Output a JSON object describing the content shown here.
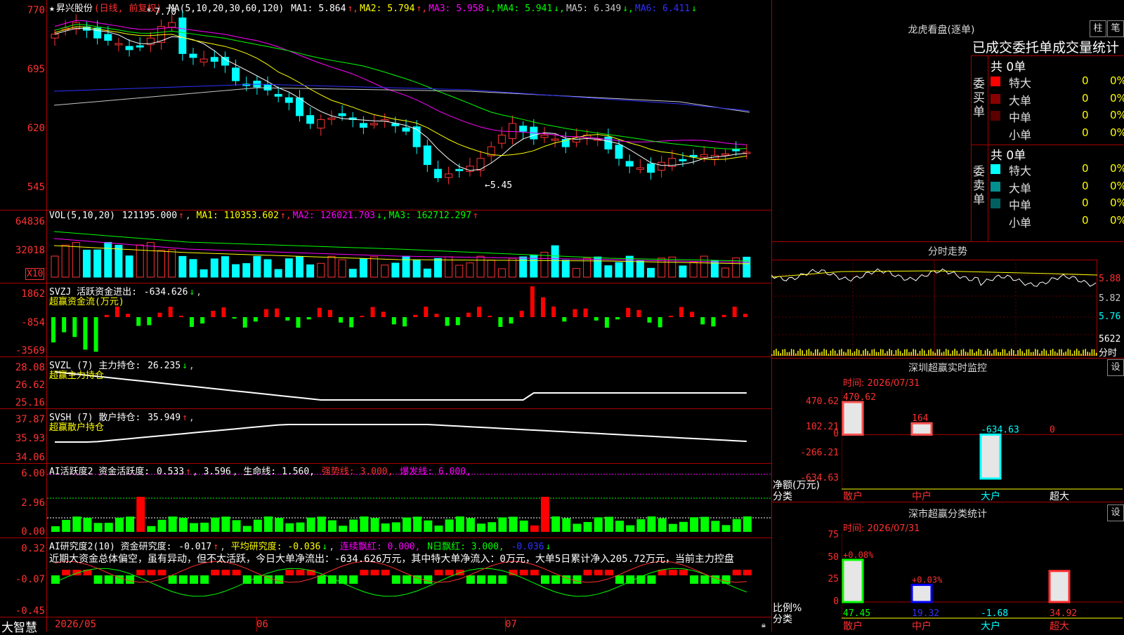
{
  "stock": {
    "name": "昇兴股份",
    "period": "(日线, 前复权)",
    "ma_params": "MA(5,10,20,30,60,120)",
    "ma_values": [
      {
        "label": "MA1:",
        "value": "5.864",
        "arrow": "↑",
        "color": "#ffffff"
      },
      {
        "label": "MA2:",
        "value": "5.794",
        "arrow": "↑",
        "color": "#ffff00"
      },
      {
        "label": "MA3:",
        "value": "5.958",
        "arrow": "↓",
        "color": "#ff00ff"
      },
      {
        "label": "MA4:",
        "value": "5.941",
        "arrow": "↓",
        "color": "#00ff00"
      },
      {
        "label": "MA5:",
        "value": "6.349",
        "arrow": "↓",
        "color": "#c8c8c8"
      },
      {
        "label": "MA6:",
        "value": "6.411",
        "arrow": "↓",
        "color": "#3030ff"
      }
    ],
    "high_marker": "7.70",
    "low_marker": "5.45",
    "price_axis": [
      "770",
      "695",
      "620",
      "545"
    ]
  },
  "volume": {
    "title": "VOL(5,10,20)",
    "value": "121195.000",
    "ma": [
      {
        "label": "MA1:",
        "value": "110353.602",
        "arrow": "↑",
        "color": "#ffff00"
      },
      {
        "label": "MA2:",
        "value": "126021.703",
        "arrow": "↓",
        "color": "#ff00ff"
      },
      {
        "label": "MA3:",
        "value": "162712.297",
        "arrow": "↑",
        "color": "#00ff00"
      }
    ],
    "axis": [
      "64836",
      "32018"
    ],
    "unit": "X10"
  },
  "svzj": {
    "title": "SVZJ  活跃资金进出:",
    "value": "-634.626",
    "arrow": "↓",
    "subtitle": "超赢资金流(万元)",
    "axis": [
      "1862",
      "-854",
      "-3569"
    ]
  },
  "svzl": {
    "title": "SVZL (7) 主力持仓:",
    "value": "26.235",
    "arrow": "↓",
    "subtitle": "超赢主力持仓",
    "axis": [
      "28.08",
      "26.62",
      "25.16"
    ]
  },
  "svsh": {
    "title": "SVSH (7) 散户持仓:",
    "value": "35.949",
    "arrow": "↑",
    "subtitle": "超赢散户持仓",
    "axis": [
      "37.87",
      "35.93",
      "34.06"
    ]
  },
  "ai1": {
    "title": "AI活跃度2 资金活跃度:",
    "v1": "0.533",
    "v2": "3.596",
    "life": "生命线: 1.560,",
    "strong": "强势线: 3.000,",
    "burst": "爆发线: 6.000,",
    "axis": [
      "6.00",
      "2.96",
      "0.00"
    ]
  },
  "ai2": {
    "title": "AI研究度2(10) 资金研究度:",
    "v1": "-0.017",
    "avg": "平均研究度: -0.036",
    "red1": "连续飘红: 0.000,",
    "red2": "N日飘红: 3.000,",
    "v3": "-0.036",
    "commentary": "近期大资金总体偏空，虽有异动，但不太活跃，今日大单净流出：-634.626万元，其中特大单净流入：0万元，大单5日累计净入205.72万元，当前主力控盘",
    "axis": [
      "0.32",
      "-0.07",
      "-0.45"
    ]
  },
  "bottom": {
    "logo": "大智慧",
    "dates": [
      "2026/05",
      "06",
      "07"
    ]
  },
  "lhb": {
    "title": "龙虎看盘(逐单)",
    "btn1": "柱",
    "btn2": "笔",
    "subtitle": "已成交委托单成交量统计",
    "buy_label": "委买单",
    "sell_label": "委卖单",
    "buy_total": "共 0单",
    "sell_total": "共 0单",
    "buy_rows": [
      {
        "name": "特大",
        "n": "0",
        "p": "0%",
        "color": "#ff0000"
      },
      {
        "name": "大单",
        "n": "0",
        "p": "0%",
        "color": "#8b0000"
      },
      {
        "name": "中单",
        "n": "0",
        "p": "0%",
        "color": "#5a0000"
      },
      {
        "name": "小单",
        "n": "0",
        "p": "0%",
        "color": ""
      }
    ],
    "sell_rows": [
      {
        "name": "特大",
        "n": "0",
        "p": "0%",
        "color": "#00ffff"
      },
      {
        "name": "大单",
        "n": "0",
        "p": "0%",
        "color": "#009090"
      },
      {
        "name": "中单",
        "n": "0",
        "p": "0%",
        "color": "#006060"
      },
      {
        "name": "小单",
        "n": "0",
        "p": "0%",
        "color": ""
      }
    ]
  },
  "intraday": {
    "title": "分时走势",
    "axis": [
      "5.88",
      "5.82",
      "5.76"
    ],
    "vol_label": "5622",
    "time_label": "分时"
  },
  "sz_monitor": {
    "title": "深圳超赢实时监控",
    "btn": "设",
    "time": "时间: 2026/07/31",
    "axis": [
      "470.62",
      "102.21",
      "0",
      "-266.21",
      "-634.63"
    ],
    "ylabel1": "净额(万元)",
    "ylabel2": "分类",
    "bars": [
      {
        "cat": "散户",
        "value": "470.62"
      },
      {
        "cat": "中户",
        "value": "164"
      },
      {
        "cat": "大户",
        "value": "-634.63"
      },
      {
        "cat": "超大",
        "value": "0"
      }
    ]
  },
  "sz_stats": {
    "title": "深市超赢分类统计",
    "btn": "设",
    "time": "时间: 2026/07/31",
    "axis": [
      "75",
      "50",
      "25",
      "0"
    ],
    "ylabel1": "比例%",
    "ylabel2": "分类",
    "bars": [
      {
        "cat": "散户",
        "value": "47.45",
        "delta": "+0.08%"
      },
      {
        "cat": "中户",
        "value": "19.32",
        "delta": "+0.03%"
      },
      {
        "cat": "大户",
        "value": "-1.68",
        "delta": ""
      },
      {
        "cat": "超大",
        "value": "34.92",
        "delta": ""
      }
    ]
  }
}
